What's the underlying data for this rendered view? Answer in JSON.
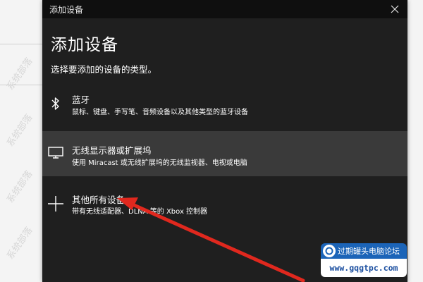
{
  "window": {
    "title": "添加设备"
  },
  "dialog": {
    "heading": "添加设备",
    "subtitle": "选择要添加的设备的类型。"
  },
  "options": [
    {
      "icon": "bluetooth-icon",
      "title": "蓝牙",
      "description": "鼠标、键盘、手写笔、音频设备以及其他类型的蓝牙设备",
      "selected": false
    },
    {
      "icon": "monitor-icon",
      "title": "无线显示器或扩展坞",
      "description": "使用 Miracast 或无线扩展坞的无线监视器、电视或电脑",
      "selected": true
    },
    {
      "icon": "plus-icon",
      "title": "其他所有设备",
      "description": "带有无线适配器、DLNA 等的 Xbox 控制器",
      "selected": false
    }
  ],
  "watermark": {
    "text": "系统部落"
  },
  "badge": {
    "name": "过期罐头电脑论坛",
    "url": "www.gqgtpc.com"
  },
  "colors": {
    "dialog_bg": "#1f1f1f",
    "titlebar_bg": "#0f0f0f",
    "selected_bg": "#3a3a3a",
    "arrow": "#e0281e",
    "badge_blue": "#1b64b8"
  }
}
